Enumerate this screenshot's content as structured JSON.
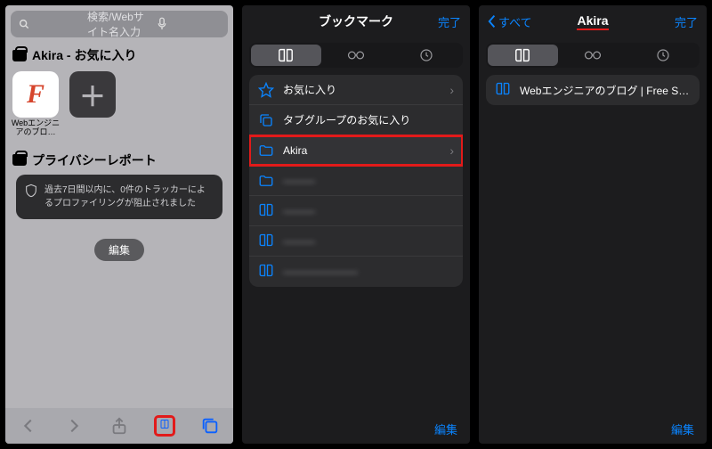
{
  "p1": {
    "search_placeholder": "検索/Webサイト名入力",
    "favorites_title": "Akira - お気に入り",
    "fav_tiles": [
      {
        "glyph": "F",
        "caption": "Webエンジニアのブロ…"
      }
    ],
    "privacy_title": "プライバシーレポート",
    "privacy_body": "過去7日間以内に、0件のトラッカーによるプロファイリングが阻止されました",
    "edit_label": "編集"
  },
  "p2": {
    "title": "ブックマーク",
    "done": "完了",
    "rows": [
      {
        "icon": "star",
        "label": "お気に入り",
        "chev": true
      },
      {
        "icon": "copy",
        "label": "タブグループのお気に入り",
        "chev": false
      },
      {
        "icon": "folder",
        "label": "Akira",
        "chev": true,
        "highlight": true
      },
      {
        "icon": "folder",
        "label": "———",
        "blur": true
      },
      {
        "icon": "book",
        "label": "———",
        "blur": true
      },
      {
        "icon": "book",
        "label": "———",
        "blur": true
      },
      {
        "icon": "book",
        "label": "———————",
        "blur": true
      }
    ],
    "edit_label": "編集"
  },
  "p3": {
    "back_label": "すべて",
    "title": "Akira",
    "done": "完了",
    "rows": [
      {
        "icon": "book",
        "label": "Webエンジニアのブログ | Free Style"
      }
    ],
    "edit_label": "編集"
  }
}
